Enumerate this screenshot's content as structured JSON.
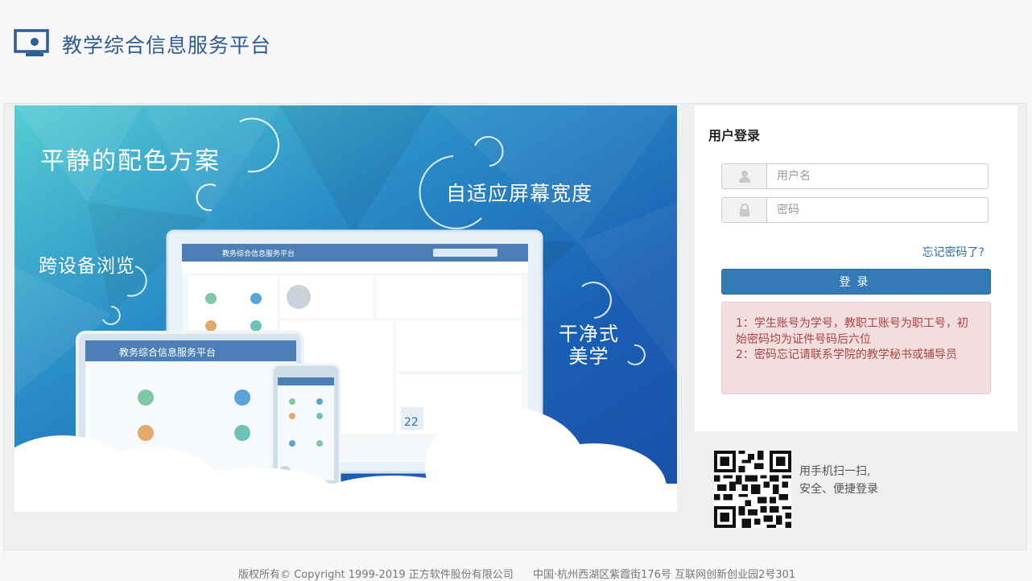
{
  "header": {
    "logo_icon": "presenter-screen-icon",
    "title": "教学综合信息服务平台"
  },
  "banner": {
    "tagline_1": "平静的配色方案",
    "tagline_2": "自适应屏幕宽度",
    "tagline_3": "跨设备浏览",
    "tagline_4a": "干净式",
    "tagline_4b": "美学",
    "mock_title": "教务综合信息服务平台",
    "colors": {
      "sky_top": "#3cc0d0",
      "sky_bottom": "#1a55b0",
      "cloud": "#ffffff"
    }
  },
  "login": {
    "title": "用户登录",
    "username_placeholder": "用户名",
    "password_placeholder": "密码",
    "username_icon": "user-icon",
    "password_icon": "lock-icon",
    "forgot_label": "忘记密码了?",
    "submit_label": "登录",
    "notice_line_1": "1：学生账号为学号，教职工账号为职工号，初始密码均为证件号码后六位",
    "notice_line_2": "2：密码忘记请联系学院的教学秘书或辅导员",
    "colors": {
      "button": "#337ab7",
      "notice_bg": "#f2dede",
      "notice_text": "#a94442"
    }
  },
  "qr": {
    "icon": "qr-code-icon",
    "line_1": "用手机扫一扫,",
    "line_2": "安全、便捷登录"
  },
  "footer": {
    "copyright": "版权所有© Copyright 1999-2019 正方软件股份有限公司",
    "address": "中国·杭州西湖区紫霞街176号 互联网创新创业园2号301"
  }
}
